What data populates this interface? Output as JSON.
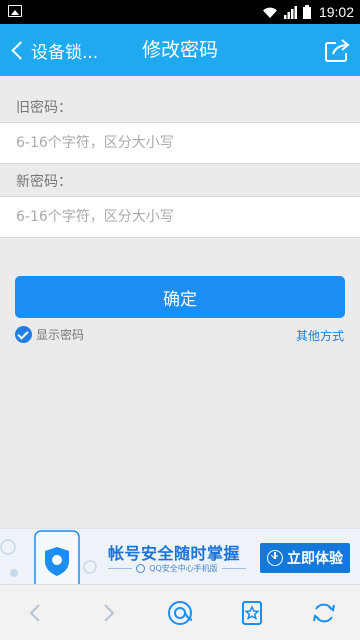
{
  "status_bar": {
    "time": "19:02",
    "icons": [
      "image-notification-icon",
      "wifi-icon",
      "signal-icon",
      "battery-icon"
    ]
  },
  "header": {
    "back_label": "设备锁...",
    "title": "修改密码",
    "share_icon": "share-icon",
    "background": "#1fa9f0"
  },
  "form": {
    "old_password": {
      "label": "旧密码：",
      "value": "",
      "placeholder": "6-16个字符，区分大小写"
    },
    "new_password": {
      "label": "新密码：",
      "value": "",
      "placeholder": "6-16个字符，区分大小写"
    },
    "confirm_button": "确定",
    "show_password": {
      "label": "显示密码",
      "checked": true
    },
    "other_methods": "其他方式"
  },
  "banner": {
    "headline": "帐号安全随时掌握",
    "subtext": "QQ安全中心手机版",
    "cta": "立即体验"
  },
  "toolbar": {
    "items": [
      "back-arrow-icon",
      "forward-arrow-icon",
      "qq-home-icon",
      "bookmark-star-icon",
      "refresh-icon"
    ]
  },
  "colors": {
    "accent": "#1a8ef2",
    "link": "#1a7fd8",
    "page_background": "#ebebeb"
  }
}
